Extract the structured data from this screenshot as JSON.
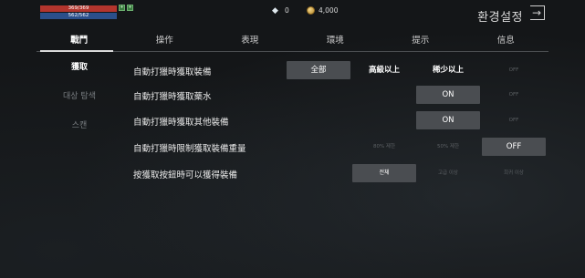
{
  "hud": {
    "hp": "369/369",
    "mp": "562/562",
    "gems": "0",
    "gold": "4,000"
  },
  "header": {
    "title": "환경설정"
  },
  "tabs": [
    "戰鬥",
    "操作",
    "表現",
    "環境",
    "提示",
    "信息"
  ],
  "side_menu": [
    "獲取",
    "대상 탐색",
    "스캔"
  ],
  "rows": [
    {
      "label": "自動打獵時獲取裝備",
      "options": [
        "全部",
        "高級以上",
        "稀少以上",
        "OFF"
      ]
    },
    {
      "label": "自動打獵時獲取藥水",
      "options": [
        "ON",
        "OFF"
      ]
    },
    {
      "label": "自動打獵時獲取其他裝備",
      "options": [
        "ON",
        "OFF"
      ]
    },
    {
      "label": "自動打獵時限制獲取裝備重量",
      "options": [
        "80% 제한",
        "50% 제한",
        "OFF"
      ]
    },
    {
      "label": "按獲取按鈕時可以獲得裝備",
      "options": [
        "전체",
        "고급 이상",
        "희귀 이상"
      ]
    }
  ],
  "colors": {
    "hp": "#b3352d",
    "mp": "#2b4f8a",
    "selected": "#4a4d51",
    "background": "#141618"
  }
}
